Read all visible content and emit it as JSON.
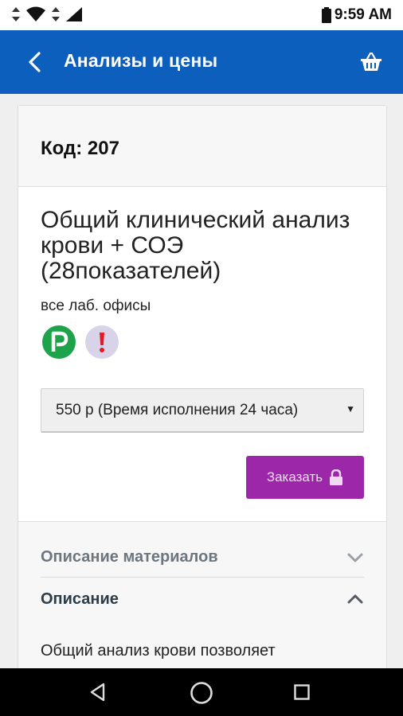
{
  "status_bar": {
    "time": "9:59 AM",
    "icons": [
      "data-arrows-icon",
      "wifi-icon",
      "data-arrows-icon",
      "signal-icon",
      "battery-icon"
    ]
  },
  "app_bar": {
    "title": "Анализы и цены",
    "back_icon": "back-arrow-icon",
    "cart_icon": "basket-icon",
    "color": "#0d5fbe"
  },
  "card": {
    "code": "Код: 207",
    "test_name": "Общий клинический анализ крови + СОЭ (28показателей)",
    "offices": "все лаб. офисы",
    "badges": [
      {
        "label": "P",
        "color": "#1fa34a"
      },
      {
        "label": "!",
        "color": "#d9d3e9"
      }
    ],
    "price_option": "550 р (Время исполнения 24 часа)",
    "order_button": "Заказать",
    "order_button_color": "#9c27a8"
  },
  "accordion": {
    "items": [
      {
        "title": "Описание материалов",
        "state": "collapsed"
      },
      {
        "title": "Описание",
        "state": "expanded"
      }
    ],
    "description_text": "Общий анализ крови позволяет"
  },
  "nav_bar": {
    "icons": [
      "back-triangle-icon",
      "home-circle-icon",
      "recents-square-icon"
    ]
  }
}
